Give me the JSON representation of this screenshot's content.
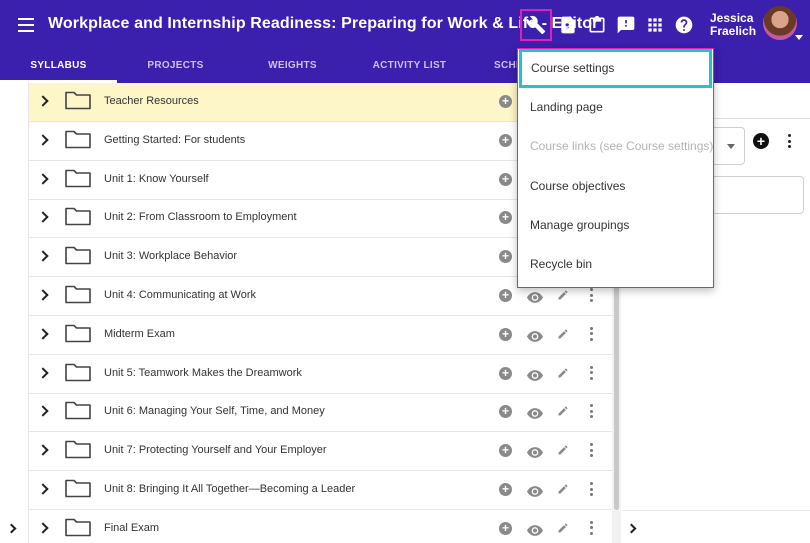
{
  "header": {
    "title": "Workplace and Internship Readiness: Preparing for Work & Life - Editor",
    "user_name": "Jessica Fraelich",
    "icons": [
      "wrench-icon",
      "preview-icon",
      "clipboard-icon",
      "feedback-icon",
      "apps-grid-icon",
      "help-icon"
    ]
  },
  "tabs": [
    {
      "label": "SYLLABUS",
      "active": true
    },
    {
      "label": "PROJECTS",
      "active": false
    },
    {
      "label": "WEIGHTS",
      "active": false
    },
    {
      "label": "ACTIVITY LIST",
      "active": false
    },
    {
      "label": "SCHE",
      "active": false
    }
  ],
  "syllabus": {
    "items": [
      {
        "label": "Teacher Resources"
      },
      {
        "label": "Getting Started: For students"
      },
      {
        "label": "Unit 1: Know Yourself"
      },
      {
        "label": "Unit 2: From Classroom to Employment"
      },
      {
        "label": "Unit 3: Workplace Behavior"
      },
      {
        "label": "Unit 4: Communicating at Work"
      },
      {
        "label": "Midterm Exam"
      },
      {
        "label": "Unit 5: Teamwork Makes the Dreamwork"
      },
      {
        "label": "Unit 6: Managing Your Self, Time, and Money"
      },
      {
        "label": "Unit 7: Protecting Yourself and Your Employer"
      },
      {
        "label": "Unit 8: Bringing It All Together—Becoming a Leader"
      },
      {
        "label": "Final Exam"
      }
    ]
  },
  "menu": {
    "items": [
      {
        "label": "Course settings",
        "state": "focused"
      },
      {
        "label": "Landing page",
        "state": "normal"
      },
      {
        "label": "Course links (see Course settings)",
        "state": "disabled"
      },
      {
        "label": "Course objectives",
        "state": "normal"
      },
      {
        "label": "Manage groupings",
        "state": "normal"
      },
      {
        "label": "Recycle bin",
        "state": "normal"
      }
    ]
  },
  "colors": {
    "header_bg": "#3b1fad",
    "highlight_row": "#fdf6c8",
    "menu_border": "#e01fb8",
    "focus_ring": "#22c3c9"
  }
}
